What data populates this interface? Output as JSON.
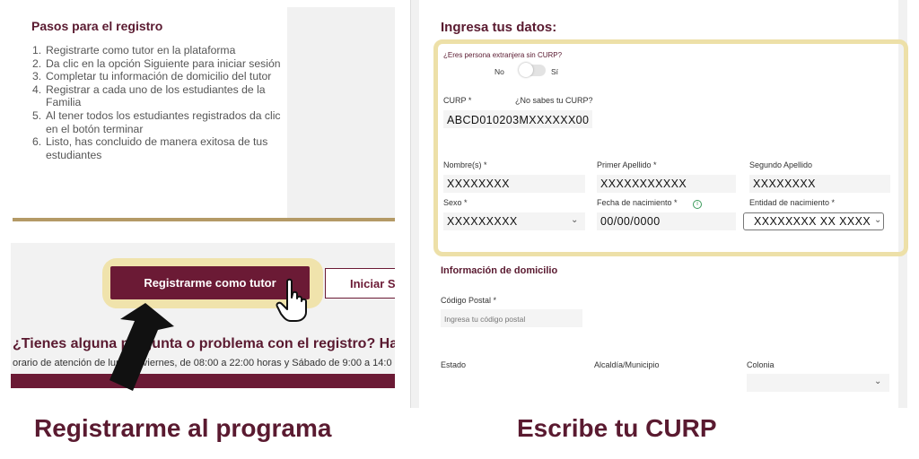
{
  "left": {
    "steps_title": "Pasos para el registro",
    "steps": [
      {
        "num": "1.",
        "text": "Registrarte como tutor en la plataforma"
      },
      {
        "num": "2.",
        "text": "Da clic en la opción Siguiente para iniciar sesión"
      },
      {
        "num": "3.",
        "text": "Completar tu información de domicilio del tutor"
      },
      {
        "num": "4.",
        "text": "Registrar a cada uno de los estudiantes de la Familia"
      },
      {
        "num": "5.",
        "text": "Al tener todos los estudiantes registrados da clic en el botón terminar"
      },
      {
        "num": "6.",
        "text": "Listo, has concluido de manera exitosa de tus estudiantes"
      }
    ],
    "tutor_button": "Registrarme como tutor",
    "start_button": "Iniciar S",
    "question": "¿Tienes alguna pregunta o problema con el registro? Ha",
    "hours": "orario de atención de lunes a viernes, de 08:00 a 22:00 horas y Sábado de 9:00 a 14:0"
  },
  "captions": {
    "left": "Registrarme al programa",
    "right": "Escribe tu CURP"
  },
  "form": {
    "title": "Ingresa tus datos:",
    "foreign_question": "¿Eres persona extranjera sin CURP?",
    "toggle_no": "No",
    "toggle_yes": "Sí",
    "curp_label": "CURP *",
    "curp_help": "¿No sabes tu CURP?",
    "curp_value": "ABCD010203MXXXXXX00",
    "nombre_label": "Nombre(s) *",
    "nombre_value": "XXXXXXXX",
    "primer_label": "Primer Apellido *",
    "primer_value": "XXXXXXXXXXX",
    "segundo_label": "Segundo Apellido",
    "segundo_value": "XXXXXXXX",
    "sexo_label": "Sexo *",
    "sexo_value": "XXXXXXXXX",
    "fecha_label": "Fecha de nacimiento *",
    "fecha_value": "00/00/0000",
    "entidad_label": "Entidad de nacimiento *",
    "entidad_value": "XXXXXXXX XX XXXX",
    "domicilio_title": "Información de domicilio",
    "cp_label": "Código Postal *",
    "cp_placeholder": "Ingresa tu código postal",
    "estado_label": "Estado",
    "alcaldia_label": "Alcaldía/Municipio",
    "colonia_label": "Colonia"
  },
  "icons": {
    "chevron": "chevron-down-icon",
    "info": "info-icon",
    "hand": "hand-pointer-icon",
    "arrow": "arrow-up-icon"
  },
  "colors": {
    "brand": "#6b1a35",
    "highlight": "#ede0a8"
  }
}
